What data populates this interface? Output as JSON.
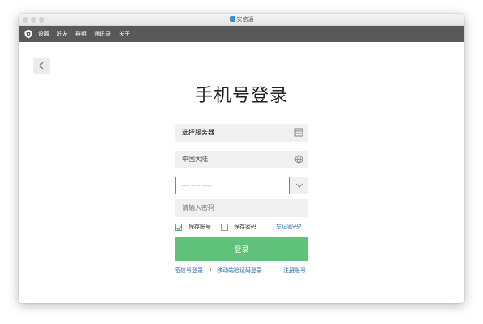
{
  "window": {
    "title": "安信通"
  },
  "menubar": {
    "items": [
      {
        "label": "设置"
      },
      {
        "label": "好友"
      },
      {
        "label": "群组"
      },
      {
        "label": "通讯录"
      },
      {
        "label": "关于"
      }
    ]
  },
  "page": {
    "title": "手机号登录"
  },
  "form": {
    "server_label": "选择服务器",
    "region_label": "中国大陆",
    "phone_placeholder": "--- ---- ----",
    "password_placeholder": "请输入密码",
    "save_account_label": "保存账号",
    "save_account_checked": true,
    "save_password_label": "保存密码",
    "save_password_checked": false,
    "forgot_password": "忘记密码?",
    "login_button": "登录"
  },
  "footer": {
    "password_login": "密信号登录",
    "separator": "/",
    "sms_login": "移动端验证码登录",
    "register": "注册账号"
  },
  "colors": {
    "menubar": "#595959",
    "primary_button": "#5fc17a",
    "link": "#2b6bb0",
    "focus_border": "#3d95d9"
  }
}
